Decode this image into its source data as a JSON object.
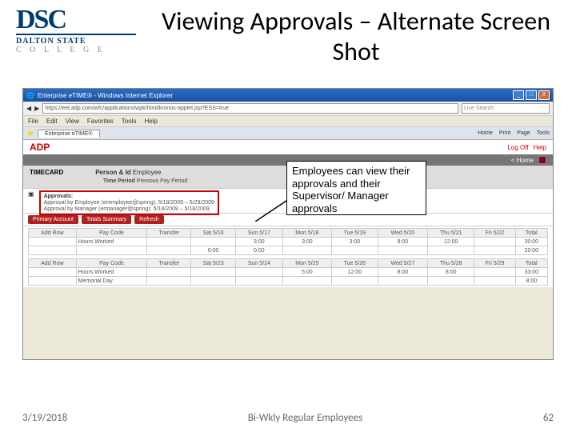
{
  "logo": {
    "abbr": "DSC",
    "name": "DALTON STATE",
    "type": "C O L L E G E"
  },
  "title": "Viewing Approvals – Alternate Screen Shot",
  "callout": "Employees can view their approvals and their Supervisor/ Manager approvals",
  "browser": {
    "window_title": "Enterprise eTIME® - Windows Internet Explorer",
    "url": "https://eet.adp.com/wfc/applications/wpk/html/kronos-applet.jsp?ESS=true",
    "search_placeholder": "Live Search",
    "menu": [
      "File",
      "Edit",
      "View",
      "Favorites",
      "Tools",
      "Help"
    ],
    "tab": "Enterprise eTIME®",
    "tools": [
      "Home",
      "Print",
      "Page",
      "Tools"
    ],
    "close": "X",
    "min": "_",
    "max": "□"
  },
  "adp": {
    "logo": "ADP",
    "logoff": "Log Off",
    "help": "Help",
    "home": "< Home"
  },
  "timecard": {
    "label": "TIMECARD",
    "person_label": "Person & Id",
    "person_value": "Employee",
    "period_label": "Time Period",
    "period_value": "Previous Pay Period"
  },
  "approvals": {
    "title": "Approvals:",
    "line1": "Approval by Employee (eremployee@spring): 5/18/2009 – 5/29/2009",
    "line2": "Approval by Manager (ermanager@spring): 5/18/2009 – 5/18/2009"
  },
  "buttons": {
    "b1": "Primary Account",
    "b2": "Totals Summary",
    "b3": "Refresh"
  },
  "grid1": {
    "head0": "Add Row",
    "head1": "Pay Code",
    "head2": "Transfer",
    "days": [
      "Sat 5/16",
      "Sun 5/17",
      "Mon 5/18",
      "Tue 5/19",
      "Wed 5/20",
      "Thu 5/21",
      "Fri 5/22",
      "Total"
    ],
    "row1_label": "Hours Worked",
    "row1": [
      "",
      "",
      "3:00",
      "3:00",
      "3:00",
      "8:00",
      "12:00",
      "",
      "30:00"
    ],
    "row2": [
      "0:00",
      "0:00",
      "",
      "",
      "",
      "",
      "",
      "20:00"
    ]
  },
  "grid2": {
    "head0": "Add Row",
    "head1": "Pay Code",
    "head2": "Transfer",
    "days": [
      "Sat 5/23",
      "Sun 5/24",
      "Mon 5/25",
      "Tue 5/26",
      "Wed 5/27",
      "Thu 5/28",
      "Fri 5/29",
      "Total"
    ],
    "row1_label": "Hours Worked",
    "row1": [
      "",
      "",
      "",
      "5:00",
      "12:00",
      "8:00",
      "8:00",
      "",
      "33:00"
    ],
    "row2_label": "Memorial Day",
    "row2": [
      "",
      "",
      "",
      "",
      "",
      "",
      "",
      "",
      "8:00"
    ]
  },
  "footer": {
    "date": "3/19/2018",
    "center": "Bi-Wkly Regular Employees",
    "page": "62"
  }
}
